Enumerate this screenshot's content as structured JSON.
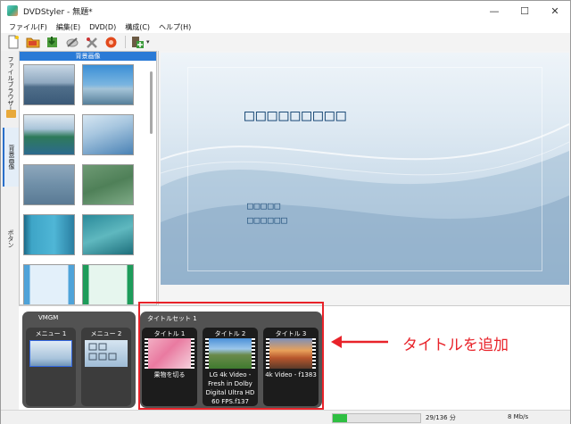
{
  "window": {
    "title": "DVDStyler - 無題*",
    "minimize": "—",
    "maximize": "☐",
    "close": "✕"
  },
  "menu": [
    "ファイル(F)",
    "編集(E)",
    "DVD(D)",
    "構成(C)",
    "ヘルプ(H)"
  ],
  "toolbar": {
    "buttons": [
      "new-file-icon",
      "open-folder-icon",
      "save-icon",
      "burn-disc-icon",
      "settings-icon",
      "record-icon",
      "add-file-icon"
    ],
    "dropdown": "▾"
  },
  "left_tabs": [
    "ファイルブラウザー",
    "背景画像",
    "ボタン"
  ],
  "panel": {
    "header": "背景画像"
  },
  "canvas": {
    "title_placeholder": "□□□□□□□□□",
    "button_placeholder_1": "□□□□□",
    "button_placeholder_2": "□□□□□□"
  },
  "vmgm": {
    "label": "VMGM",
    "menus": [
      "メニュー 1",
      "メニュー 2"
    ]
  },
  "titleset": {
    "label": "タイトルセット 1",
    "titles": [
      {
        "label": "タイトル 1",
        "caption": "果物を切る"
      },
      {
        "label": "タイトル 2",
        "caption": "LG 4k Video - Fresh in Dolby Digital Ultra HD 60 FPS.f137"
      },
      {
        "label": "タイトル 3",
        "caption": "4k Video - f1383"
      }
    ]
  },
  "annotation": {
    "text": "タイトルを追加",
    "color": "#e8232a"
  },
  "status": {
    "progress": 0.16,
    "capacity": "29/136 分",
    "bitrate": "8 Mb/s"
  }
}
